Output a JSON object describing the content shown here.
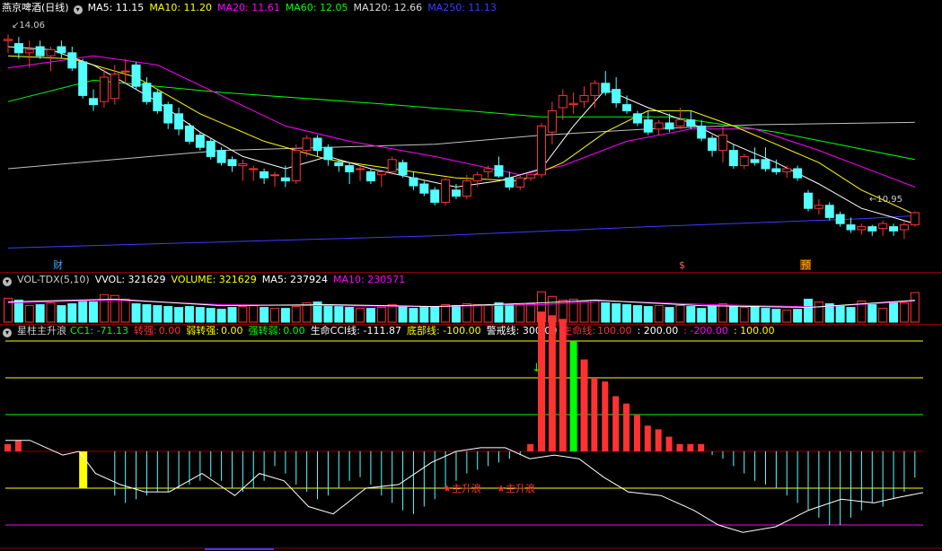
{
  "main_header": {
    "stock": "燕京啤酒(日线)",
    "ma5": "MA5: 11.15",
    "ma10": "MA10: 11.20",
    "ma20": "MA20: 11.61",
    "ma60": "MA60: 12.05",
    "ma120": "MA120: 12.66",
    "ma250": "MA250: 11.13"
  },
  "price_labels": {
    "high": "14.06",
    "low": "10.95"
  },
  "event_marks": [
    "财",
    "$",
    "预"
  ],
  "vol_header": {
    "name": "VOL-TDX(5,10)",
    "vvol": "VVOL: 321629",
    "volume": "VOLUME: 321629",
    "ma5": "MA5: 237924",
    "ma10": "MA10: 230571"
  },
  "ind_header": {
    "name": "星柱主升浪",
    "cc1": "CC1: -71.13",
    "zhuanqiang_label": "转强:",
    "zhuanqiang": "0.00",
    "ruozhuanqiang_label": "弱转强:",
    "ruozhuanqiang": "0.00",
    "qiangzhuanruo_label": "强转弱:",
    "qiangzhuanruo": "0.00",
    "cci": "生命CCI线: -111.87",
    "dibu": "底部线: -100.00",
    "jingjie": "警戒线: 300.00",
    "shengming_label": "生命线:",
    "shengming": "100.00",
    "v200": ": 200.00",
    "vm200": ": -200.00",
    "v100": ": 100.00"
  },
  "signal_labels": [
    "主升浪",
    "主升浪"
  ],
  "colors": {
    "up": "#ff3232",
    "down": "#54ffff",
    "ma5": "#ffffff",
    "ma10": "#ffff00",
    "ma20": "#ff00ff",
    "ma60": "#00ff00",
    "ma120": "#c0c0c0",
    "ma250": "#3c3cff",
    "cci": "#ffffff"
  },
  "chart_data": [
    {
      "type": "candlestick",
      "title": "燕京啤酒(日线)",
      "ylim": [
        10.4,
        14.4
      ],
      "candles": [
        [
          14.0,
          14.1,
          13.8,
          14.02
        ],
        [
          13.95,
          14.06,
          13.7,
          13.8
        ],
        [
          13.8,
          14.0,
          13.55,
          13.85
        ],
        [
          13.9,
          14.0,
          13.7,
          13.75
        ],
        [
          13.75,
          13.9,
          13.5,
          13.85
        ],
        [
          13.9,
          14.0,
          13.7,
          13.8
        ],
        [
          13.8,
          13.9,
          13.5,
          13.55
        ],
        [
          13.65,
          13.7,
          13.05,
          13.1
        ],
        [
          13.05,
          13.2,
          12.85,
          12.95
        ],
        [
          13.0,
          13.55,
          12.9,
          13.4
        ],
        [
          13.05,
          13.6,
          12.95,
          13.45
        ],
        [
          13.5,
          13.7,
          13.3,
          13.5
        ],
        [
          13.6,
          13.65,
          13.2,
          13.25
        ],
        [
          13.3,
          13.4,
          12.95,
          13.0
        ],
        [
          13.15,
          13.2,
          12.8,
          12.85
        ],
        [
          12.95,
          13.0,
          12.55,
          12.65
        ],
        [
          12.8,
          12.9,
          12.45,
          12.55
        ],
        [
          12.6,
          12.65,
          12.3,
          12.35
        ],
        [
          12.45,
          12.5,
          12.2,
          12.25
        ],
        [
          12.35,
          12.4,
          12.05,
          12.1
        ],
        [
          12.2,
          12.25,
          11.95,
          12.0
        ],
        [
          12.05,
          12.1,
          11.85,
          11.95
        ],
        [
          11.95,
          12.05,
          11.7,
          11.98
        ],
        [
          11.9,
          11.95,
          11.7,
          11.9
        ],
        [
          11.85,
          11.9,
          11.65,
          11.75
        ],
        [
          11.8,
          11.85,
          11.6,
          11.8
        ],
        [
          11.75,
          11.95,
          11.6,
          11.7
        ],
        [
          11.7,
          12.3,
          11.65,
          12.2
        ],
        [
          12.2,
          12.45,
          12.1,
          12.4
        ],
        [
          12.4,
          12.45,
          12.1,
          12.2
        ],
        [
          12.25,
          12.3,
          11.95,
          12.05
        ],
        [
          12.0,
          12.05,
          11.85,
          11.95
        ],
        [
          11.95,
          12.0,
          11.65,
          11.85
        ],
        [
          11.9,
          11.95,
          11.7,
          11.9
        ],
        [
          11.85,
          11.9,
          11.65,
          11.7
        ],
        [
          11.8,
          11.85,
          11.6,
          11.85
        ],
        [
          11.85,
          12.1,
          11.8,
          12.05
        ],
        [
          12.0,
          12.05,
          11.75,
          11.8
        ],
        [
          11.75,
          11.85,
          11.55,
          11.62
        ],
        [
          11.65,
          11.7,
          11.45,
          11.5
        ],
        [
          11.55,
          11.6,
          11.3,
          11.35
        ],
        [
          11.35,
          11.75,
          11.3,
          11.72
        ],
        [
          11.55,
          11.65,
          11.4,
          11.45
        ],
        [
          11.45,
          11.8,
          11.4,
          11.7
        ],
        [
          11.7,
          11.85,
          11.6,
          11.8
        ],
        [
          11.85,
          11.95,
          11.75,
          11.9
        ],
        [
          11.95,
          12.1,
          11.75,
          11.78
        ],
        [
          11.75,
          11.85,
          11.55,
          11.6
        ],
        [
          11.6,
          11.8,
          11.55,
          11.75
        ],
        [
          11.75,
          11.8,
          11.7,
          11.8
        ],
        [
          11.8,
          12.65,
          11.75,
          12.6
        ],
        [
          12.5,
          13.0,
          12.3,
          12.85
        ],
        [
          12.9,
          13.2,
          12.7,
          13.1
        ],
        [
          12.95,
          13.15,
          12.8,
          12.97
        ],
        [
          13.0,
          13.25,
          12.9,
          13.1
        ],
        [
          13.1,
          13.35,
          12.9,
          13.3
        ],
        [
          13.3,
          13.5,
          13.1,
          13.15
        ],
        [
          13.2,
          13.4,
          12.9,
          12.98
        ],
        [
          12.95,
          13.1,
          12.8,
          12.85
        ],
        [
          12.8,
          12.85,
          12.6,
          12.65
        ],
        [
          12.7,
          12.85,
          12.45,
          12.5
        ],
        [
          12.55,
          12.7,
          12.45,
          12.65
        ],
        [
          12.65,
          12.8,
          12.5,
          12.55
        ],
        [
          12.6,
          12.9,
          12.55,
          12.7
        ],
        [
          12.7,
          12.85,
          12.55,
          12.6
        ],
        [
          12.6,
          12.7,
          12.35,
          12.4
        ],
        [
          12.4,
          12.45,
          12.1,
          12.2
        ],
        [
          12.2,
          12.6,
          12.0,
          12.45
        ],
        [
          12.2,
          12.3,
          11.9,
          11.95
        ],
        [
          11.95,
          12.15,
          11.9,
          12.1
        ],
        [
          12.05,
          12.25,
          11.95,
          12.0
        ],
        [
          12.05,
          12.25,
          11.85,
          11.9
        ],
        [
          11.9,
          12.05,
          11.8,
          11.85
        ],
        [
          11.85,
          11.95,
          11.75,
          11.9
        ],
        [
          11.9,
          11.95,
          11.7,
          11.75
        ],
        [
          11.5,
          11.55,
          11.2,
          11.25
        ],
        [
          11.25,
          11.4,
          11.15,
          11.3
        ],
        [
          11.3,
          11.35,
          11.05,
          11.1
        ],
        [
          11.15,
          11.2,
          10.95,
          11.0
        ],
        [
          10.98,
          11.1,
          10.85,
          10.9
        ],
        [
          10.9,
          11.0,
          10.82,
          10.95
        ],
        [
          10.95,
          10.98,
          10.8,
          10.88
        ],
        [
          10.92,
          11.05,
          10.8,
          11.0
        ],
        [
          10.95,
          11.0,
          10.8,
          10.88
        ],
        [
          10.9,
          11.05,
          10.75,
          10.98
        ],
        [
          10.98,
          11.2,
          10.95,
          11.18
        ]
      ],
      "ma5_points": [
        [
          0,
          13.9
        ],
        [
          4,
          13.85
        ],
        [
          8,
          13.6
        ],
        [
          11,
          13.3
        ],
        [
          14,
          13.0
        ],
        [
          18,
          12.5
        ],
        [
          22,
          12.1
        ],
        [
          26,
          11.9
        ],
        [
          30,
          12.1
        ],
        [
          34,
          11.9
        ],
        [
          38,
          11.75
        ],
        [
          42,
          11.6
        ],
        [
          46,
          11.7
        ],
        [
          50,
          11.9
        ],
        [
          53,
          12.6
        ],
        [
          56,
          13.2
        ],
        [
          60,
          12.9
        ],
        [
          64,
          12.65
        ],
        [
          68,
          12.3
        ],
        [
          72,
          12.0
        ],
        [
          76,
          11.65
        ],
        [
          80,
          11.25
        ],
        [
          85,
          11.0
        ]
      ],
      "ma10_points": [
        [
          0,
          13.75
        ],
        [
          6,
          13.7
        ],
        [
          12,
          13.4
        ],
        [
          18,
          12.8
        ],
        [
          24,
          12.35
        ],
        [
          30,
          12.05
        ],
        [
          36,
          11.9
        ],
        [
          42,
          11.75
        ],
        [
          48,
          11.7
        ],
        [
          52,
          12.0
        ],
        [
          56,
          12.5
        ],
        [
          60,
          12.85
        ],
        [
          64,
          12.85
        ],
        [
          68,
          12.6
        ],
        [
          72,
          12.3
        ],
        [
          76,
          12.0
        ],
        [
          80,
          11.55
        ],
        [
          85,
          11.15
        ]
      ],
      "ma20_points": [
        [
          0,
          13.55
        ],
        [
          8,
          13.75
        ],
        [
          14,
          13.6
        ],
        [
          20,
          13.1
        ],
        [
          26,
          12.6
        ],
        [
          32,
          12.35
        ],
        [
          40,
          12.1
        ],
        [
          48,
          11.8
        ],
        [
          52,
          11.95
        ],
        [
          58,
          12.35
        ],
        [
          64,
          12.55
        ],
        [
          70,
          12.55
        ],
        [
          76,
          12.2
        ],
        [
          82,
          11.8
        ],
        [
          85,
          11.6
        ]
      ],
      "ma60_points": [
        [
          0,
          13.0
        ],
        [
          8,
          13.35
        ],
        [
          20,
          13.15
        ],
        [
          36,
          12.95
        ],
        [
          50,
          12.75
        ],
        [
          62,
          12.75
        ],
        [
          72,
          12.5
        ],
        [
          85,
          12.05
        ]
      ],
      "ma120_points": [
        [
          0,
          11.9
        ],
        [
          10,
          12.05
        ],
        [
          20,
          12.2
        ],
        [
          30,
          12.25
        ],
        [
          40,
          12.3
        ],
        [
          50,
          12.45
        ],
        [
          60,
          12.55
        ],
        [
          70,
          12.62
        ],
        [
          85,
          12.66
        ]
      ],
      "ma250_points": [
        [
          0,
          10.6
        ],
        [
          20,
          10.7
        ],
        [
          40,
          10.8
        ],
        [
          60,
          10.95
        ],
        [
          80,
          11.08
        ],
        [
          85,
          11.13
        ]
      ]
    },
    {
      "type": "bar",
      "title": "VOL-TDX(5,10)",
      "ylim": [
        0,
        400000
      ],
      "values": [
        260000,
        240000,
        180000,
        190000,
        210000,
        180000,
        200000,
        230000,
        220000,
        300000,
        290000,
        250000,
        200000,
        190000,
        180000,
        170000,
        160000,
        170000,
        160000,
        150000,
        140000,
        160000,
        170000,
        180000,
        160000,
        150000,
        150000,
        170000,
        210000,
        220000,
        190000,
        170000,
        160000,
        150000,
        150000,
        160000,
        190000,
        170000,
        150000,
        160000,
        170000,
        190000,
        180000,
        200000,
        190000,
        180000,
        210000,
        190000,
        190000,
        200000,
        330000,
        280000,
        240000,
        250000,
        230000,
        240000,
        210000,
        200000,
        190000,
        180000,
        170000,
        180000,
        160000,
        180000,
        170000,
        150000,
        170000,
        200000,
        170000,
        160000,
        170000,
        150000,
        140000,
        130000,
        140000,
        250000,
        220000,
        200000,
        180000,
        160000,
        230000,
        190000,
        150000,
        220000,
        210000,
        321629
      ],
      "ma5": [
        [
          0,
          220000
        ],
        [
          10,
          250000
        ],
        [
          20,
          180000
        ],
        [
          30,
          190000
        ],
        [
          40,
          170000
        ],
        [
          50,
          210000
        ],
        [
          55,
          240000
        ],
        [
          65,
          180000
        ],
        [
          75,
          160000
        ],
        [
          85,
          237924
        ]
      ],
      "ma10": [
        [
          0,
          210000
        ],
        [
          10,
          240000
        ],
        [
          20,
          190000
        ],
        [
          30,
          180000
        ],
        [
          40,
          170000
        ],
        [
          50,
          190000
        ],
        [
          56,
          230000
        ],
        [
          66,
          190000
        ],
        [
          76,
          165000
        ],
        [
          85,
          230571
        ]
      ]
    },
    {
      "type": "bar",
      "title": "星柱主升浪",
      "ylim": [
        -350,
        400
      ],
      "levels": [
        300,
        200,
        100,
        0,
        -100,
        -200
      ],
      "bars": [
        20,
        30,
        0,
        0,
        0,
        0,
        0,
        0,
        0,
        0,
        -120,
        -140,
        -130,
        -120,
        -110,
        -110,
        -100,
        -90,
        -80,
        -70,
        -80,
        -100,
        -110,
        -100,
        -80,
        -40,
        -60,
        -90,
        -110,
        -130,
        -120,
        -100,
        -80,
        -70,
        -90,
        -120,
        -140,
        -160,
        -170,
        -150,
        -130,
        -100,
        -80,
        -60,
        -50,
        -40,
        -30,
        -20,
        -10,
        20,
        380,
        370,
        360,
        300,
        250,
        200,
        190,
        150,
        130,
        100,
        70,
        60,
        40,
        20,
        20,
        20,
        -10,
        -20,
        -40,
        -60,
        -80,
        -90,
        -100,
        -120,
        -140,
        -160,
        -180,
        -200,
        -200,
        -180,
        -160,
        -140,
        -150,
        -130,
        -110,
        -71.13
      ],
      "cci_points": [
        [
          0,
          30
        ],
        [
          3,
          30
        ],
        [
          5,
          10
        ],
        [
          7,
          -10
        ],
        [
          9,
          0
        ],
        [
          11,
          -60
        ],
        [
          14,
          -90
        ],
        [
          17,
          -110
        ],
        [
          20,
          -110
        ],
        [
          24,
          -60
        ],
        [
          28,
          -120
        ],
        [
          31,
          -60
        ],
        [
          34,
          -80
        ],
        [
          37,
          -150
        ],
        [
          40,
          -170
        ],
        [
          44,
          -100
        ],
        [
          48,
          -90
        ],
        [
          50,
          -60
        ],
        [
          52,
          -30
        ],
        [
          55,
          0
        ],
        [
          58,
          10
        ],
        [
          61,
          10
        ],
        [
          64,
          -20
        ],
        [
          67,
          -10
        ],
        [
          70,
          -20
        ],
        [
          73,
          -70
        ],
        [
          76,
          -110
        ],
        [
          80,
          -120
        ],
        [
          84,
          -160
        ],
        [
          87,
          -200
        ],
        [
          90,
          -220
        ],
        [
          94,
          -205
        ],
        [
          98,
          -160
        ],
        [
          102,
          -130
        ],
        [
          106,
          -140
        ],
        [
          109,
          -125
        ],
        [
          112,
          -111.87
        ]
      ]
    }
  ]
}
